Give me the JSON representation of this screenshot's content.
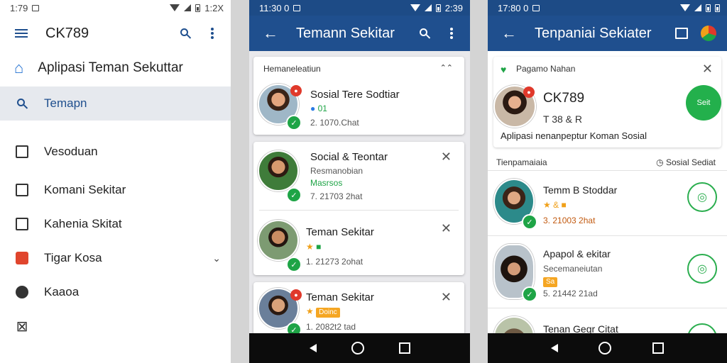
{
  "screen1": {
    "status_time": "1:79",
    "status_right": "1:2X",
    "app_title": "CK789",
    "header_label": "Aplipasi Teman Sekuttar",
    "menu": [
      {
        "label": "Temapn",
        "icon": "search-icon",
        "active": true
      },
      {
        "label": "Vesoduan",
        "icon": "inbox-icon"
      },
      {
        "label": "Komani Sekitar",
        "icon": "people-icon"
      },
      {
        "label": "Kahenia Skitat",
        "icon": "image-icon"
      },
      {
        "label": "Tigar Kosa",
        "icon": "chat-icon"
      },
      {
        "label": "Kaaoa",
        "icon": "circle-icon"
      }
    ]
  },
  "screen2": {
    "status_time": "11:30 0",
    "status_right": "2:39",
    "app_title": "Temann Sekitar",
    "cards": [
      {
        "header": "Hemaneleatiun",
        "name": "Sosial Tere Sodtiar",
        "tag": "01",
        "meta": "2. 1070.Chat"
      },
      {
        "name": "Social & Teontar",
        "sub": "Resmanobian",
        "sub2": "Masrsos",
        "meta": "7. 21703 2hat"
      },
      {
        "name": "Teman Sekitar",
        "meta": "1. 21273 2ohat"
      },
      {
        "name": "Teman Sekitar",
        "chip": "Doinc",
        "meta": "1. 2082t2 tad"
      }
    ]
  },
  "screen3": {
    "status_time": "17:80 0",
    "app_title": "Tenpaniai Sekiater",
    "card_header": "Pagamo Nahan",
    "profile_name": "CK789",
    "profile_stats": "T  38 & R",
    "profile_desc": "Aplipasi nenanpeptur Koman Sosial",
    "profile_button": "Seit",
    "section_title": "Tienpamaiaia",
    "section_action": "Sosial Sediat",
    "people": [
      {
        "name": "Temm B Stoddar",
        "meta": "3. 21003 2hat"
      },
      {
        "name": "Apapol & ekitar",
        "sub": "Secemaneiutan",
        "tag": "Sa",
        "meta": "5. 21442 21ad"
      },
      {
        "name": "Tenan Gegr Citat"
      }
    ]
  }
}
